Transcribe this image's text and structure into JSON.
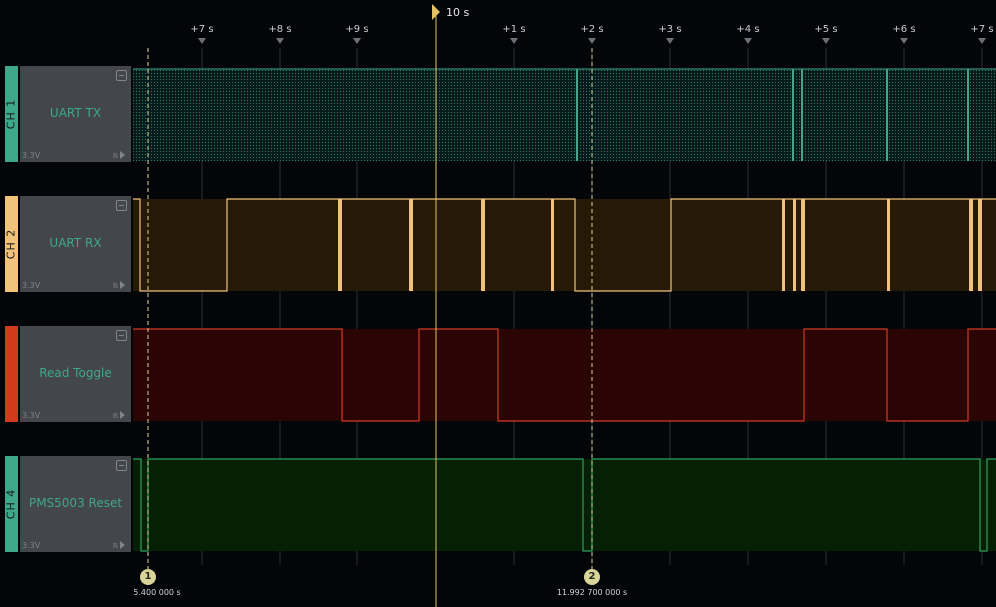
{
  "timeline": {
    "origin_label": "10 s",
    "ticks": [
      "+7 s",
      "+8 s",
      "+9 s",
      "+1 s",
      "+2 s",
      "+3 s",
      "+4 s",
      "+5 s",
      "+6 s",
      "+7 s"
    ]
  },
  "markers": [
    {
      "id": "1",
      "time": "5.400 000 s"
    },
    {
      "id": "2",
      "time": "11.992 700 000 s"
    }
  ],
  "channels": [
    {
      "tab": "CH 1",
      "name": "UART TX",
      "voltage": "3.3V",
      "color": "#3fa78a"
    },
    {
      "tab": "CH 2",
      "name": "UART RX",
      "voltage": "3.3V",
      "color": "#f0c27b"
    },
    {
      "tab": "",
      "name": "Read Toggle",
      "voltage": "3.3V",
      "color": "#d23a1e"
    },
    {
      "tab": "CH 4",
      "name": "PMS5003 Reset",
      "voltage": "3.3V",
      "color": "#2fa05a"
    }
  ],
  "channel_panel": {
    "trigger_glyph": "ℝ"
  },
  "colors": {
    "background": "#030508",
    "gridline": "#2b2f36",
    "origin_line": "#e3c266",
    "marker": "#d8d49a",
    "ch1_fill": "#0b2a26",
    "ch2_fill": "#261a06",
    "ch3_fill": "#2a0504",
    "ch4_fill": "#062006"
  }
}
